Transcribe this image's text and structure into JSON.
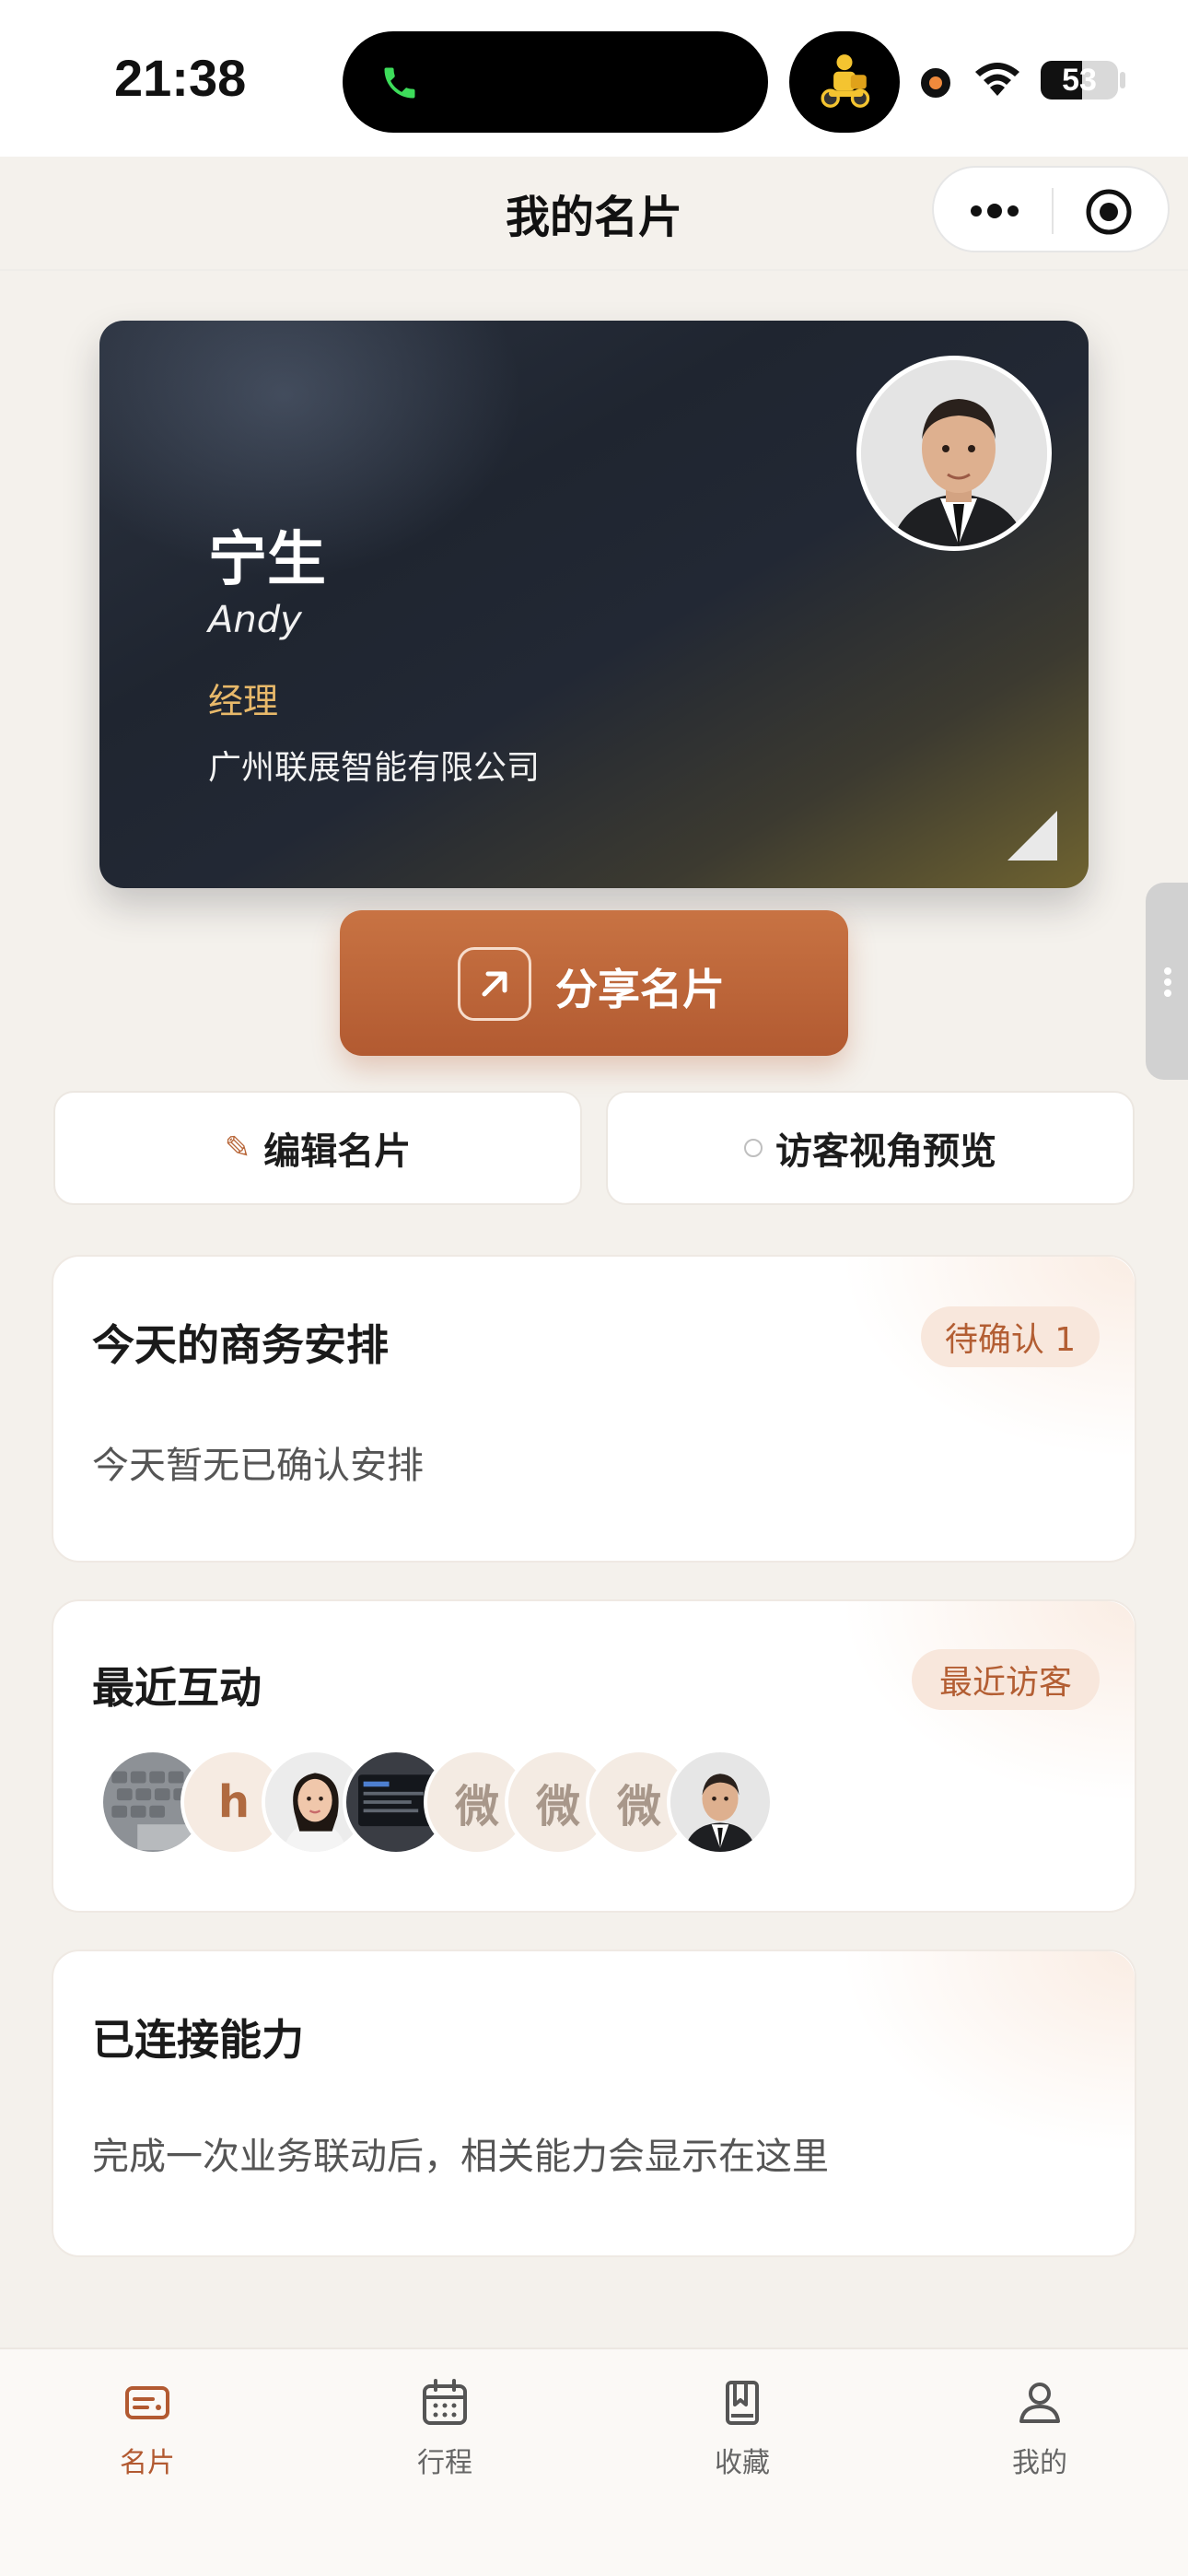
{
  "status_bar": {
    "time": "21:38",
    "battery_level": "53",
    "battery_fraction": 0.53
  },
  "nav": {
    "title": "我的名片",
    "more_icon": "more-dots-icon",
    "close_icon": "target-circle-icon"
  },
  "card": {
    "name": "宁生",
    "english_name": "Andy",
    "job_title": "经理",
    "company": "广州联展智能有限公司",
    "colors": {
      "title": "#e8b96a",
      "background": "#1f2530"
    }
  },
  "actions": {
    "share_label": "分享名片",
    "edit_label": "编辑名片",
    "preview_label": "访客视角预览"
  },
  "schedule": {
    "title": "今天的商务安排",
    "pending_badge": "待确认 1",
    "empty_text": "今天暂无已确认安排"
  },
  "interactions": {
    "title": "最近互动",
    "visitors_badge": "最近访客",
    "avatars": [
      {
        "kind": "image",
        "label": "keyboard-avatar"
      },
      {
        "kind": "text",
        "text": "h"
      },
      {
        "kind": "image",
        "label": "woman-avatar"
      },
      {
        "kind": "image",
        "label": "screen-avatar"
      },
      {
        "kind": "text",
        "text": "微"
      },
      {
        "kind": "text",
        "text": "微"
      },
      {
        "kind": "text",
        "text": "微"
      },
      {
        "kind": "image",
        "label": "man-avatar"
      }
    ]
  },
  "capabilities": {
    "title": "已连接能力",
    "empty_text": "完成一次业务联动后，相关能力会显示在这里"
  },
  "tabbar": {
    "accent": "#b25a31",
    "items": [
      {
        "label": "名片",
        "icon": "card-icon",
        "active": true
      },
      {
        "label": "行程",
        "icon": "calendar-icon",
        "active": false
      },
      {
        "label": "收藏",
        "icon": "bookmark-book-icon",
        "active": false
      },
      {
        "label": "我的",
        "icon": "user-icon",
        "active": false
      }
    ]
  }
}
